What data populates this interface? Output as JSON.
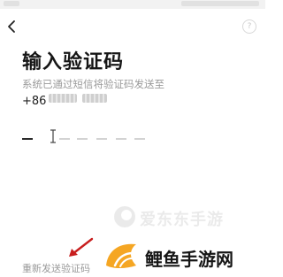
{
  "header": {
    "back_icon": "chevron-left-icon",
    "help_label": "?"
  },
  "main": {
    "title": "输入验证码",
    "subtitle": "系统已通过短信将验证码发送至",
    "phone_prefix": "+86",
    "code_length": 6,
    "resend_label": "重新发送验证码"
  },
  "overlay": {
    "watermark_text": "爱东东手游",
    "site_name": "鲤鱼手游网",
    "arrow_color": "#c81e1e",
    "logo_color": "#f5a623"
  }
}
